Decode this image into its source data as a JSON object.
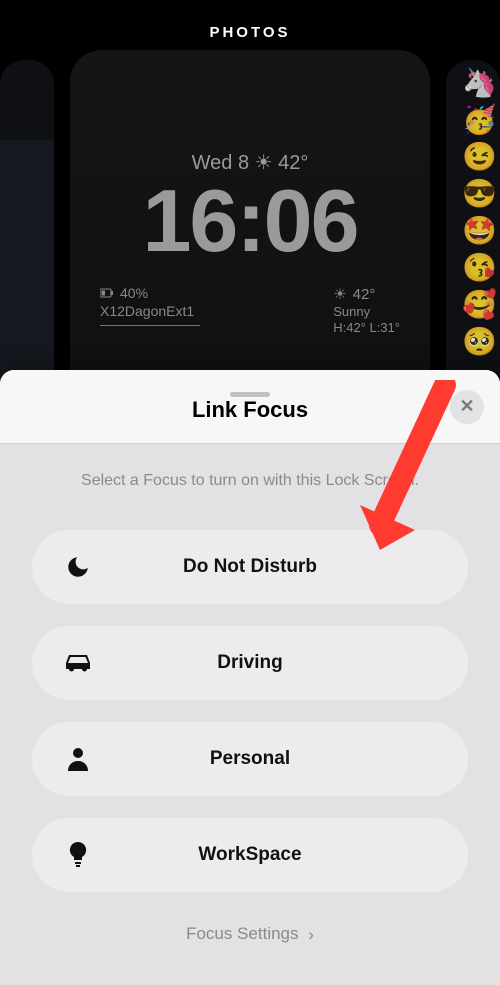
{
  "header": {
    "label": "PHOTOS"
  },
  "lock": {
    "dateline": "Wed 8  ☀︎  42°",
    "time": "16:06",
    "battery_pct": "40%",
    "wifi_name": "X12DagonExt1",
    "temp_big": "42°",
    "condition": "Sunny",
    "hi_lo": "H:42° L:31°"
  },
  "sheet": {
    "title": "Link Focus",
    "subtitle": "Select a Focus to turn on with this Lock Screen.",
    "close_label": "✕",
    "focuses": [
      {
        "icon": "moon",
        "label": "Do Not Disturb"
      },
      {
        "icon": "car",
        "label": "Driving"
      },
      {
        "icon": "person",
        "label": "Personal"
      },
      {
        "icon": "bulb",
        "label": "WorkSpace"
      }
    ],
    "settings_link": "Focus Settings"
  },
  "peek_right_emojis": [
    "🦄",
    "🥳",
    "😉",
    "😎",
    "🤩",
    "😘",
    "🥰",
    "🥺"
  ]
}
